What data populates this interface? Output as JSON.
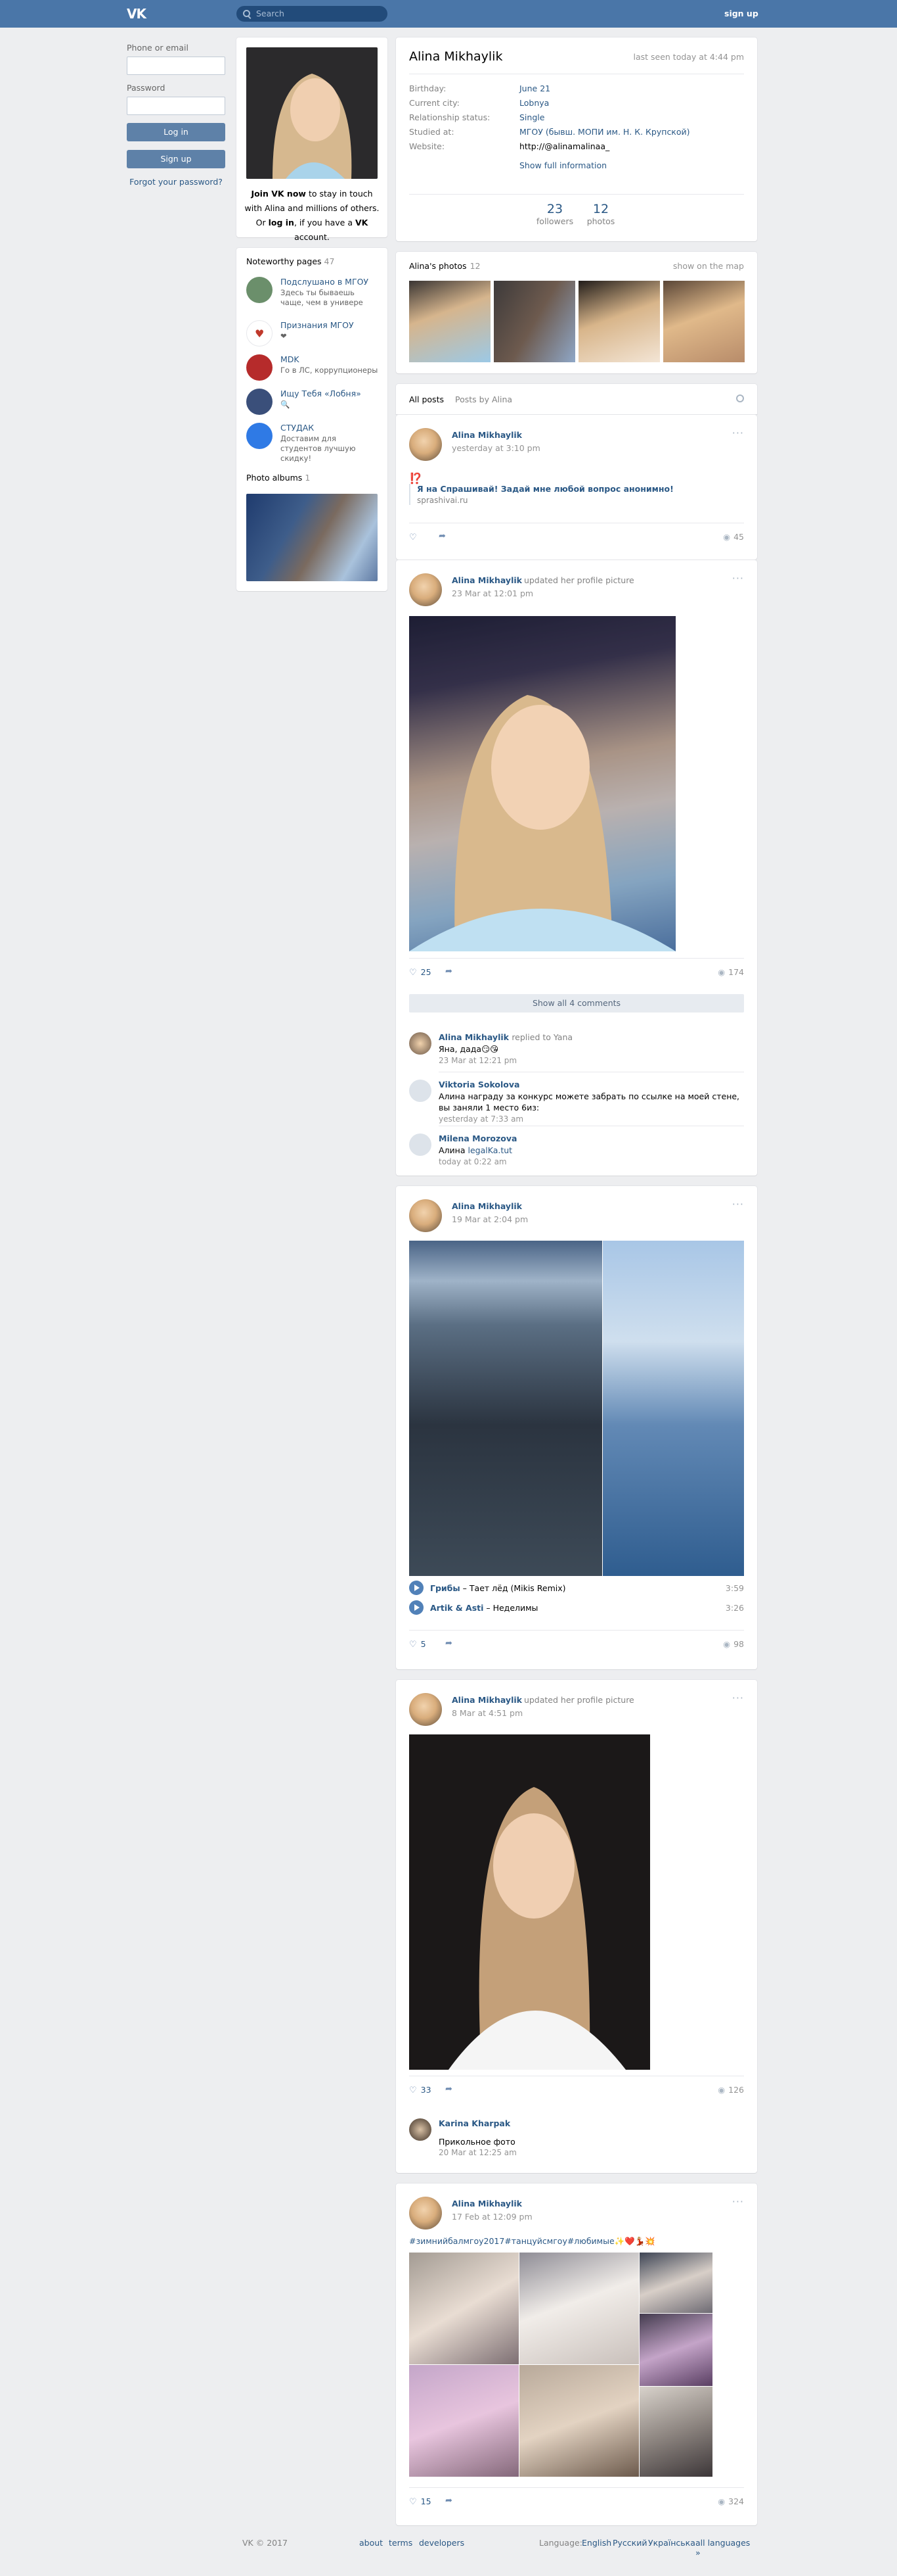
{
  "header": {
    "logo": "VK",
    "search_placeholder": "Search",
    "signup": "sign up"
  },
  "login": {
    "phone_label": "Phone or email",
    "password_label": "Password",
    "login_button": "Log in",
    "signup_button": "Sign up",
    "forgot": "Forgot your password?"
  },
  "sidebar": {
    "join_text_1": "Join VK now",
    "join_text_2": " to stay in touch with Alina and millions of others.",
    "join_text_3": "Or ",
    "join_text_4": "log in",
    "join_text_5": ", if you have a ",
    "join_text_6": "VK",
    "join_text_7": " account.",
    "noteworthy_title": "Noteworthy pages",
    "noteworthy_count": "47",
    "pages": [
      {
        "name": "Подслушано в МГОУ",
        "desc": "Здесь ты бываешь чаще, чем в универе",
        "color": "#6b8f6b"
      },
      {
        "name": "Признания МГОУ",
        "desc": "❤",
        "color": "#ffffff"
      },
      {
        "name": "MDK",
        "desc": "Го в ЛС, коррупционеры",
        "color": "#b62b2b"
      },
      {
        "name": "Ищу Тебя «Лобня»",
        "desc": "🔍",
        "color": "#3a4f7a"
      },
      {
        "name": "СТУДАК",
        "desc": "Доставим для студентов лучшую скидку!",
        "color": "#2f7ae5"
      }
    ],
    "albums_title": "Photo albums",
    "albums_count": "1"
  },
  "profile": {
    "name": "Alina Mikhaylik",
    "last_seen": "last seen today at 4:44 pm",
    "rows": [
      {
        "k": "Birthday:",
        "v": "June 21",
        "link": true
      },
      {
        "k": "Current city:",
        "v": "Lobnya",
        "link": true
      },
      {
        "k": "Relationship status:",
        "v": "Single",
        "link": true
      },
      {
        "k": "Studied at:",
        "v": "МГОУ (бывш. МОПИ им. Н. К. Крупской)",
        "link": true
      },
      {
        "k": "Website:",
        "v": "http://@alinamalinaa_",
        "link": false
      }
    ],
    "show_full": "Show full information",
    "followers_n": "23",
    "followers_t": "followers",
    "photos_n": "12",
    "photos_t": "photos"
  },
  "photos_block": {
    "title": "Alina's photos",
    "count": "12",
    "map": "show on the map"
  },
  "tabs": {
    "all": "All posts",
    "by": "Posts by Alina"
  },
  "posts": [
    {
      "author": "Alina Mikhaylik",
      "date": "yesterday at 3:10 pm",
      "mark": "⁉️",
      "link_title": "Я на Спрашивай! Задай мне любой вопрос анонимно!",
      "link_domain": "sprashivai.ru",
      "views": "45"
    },
    {
      "author": "Alina Mikhaylik",
      "action": "updated her profile picture",
      "date": "23 Mar at 12:01 pm",
      "likes": "25",
      "views": "174",
      "show_comments": "Show all 4 comments",
      "comments": [
        {
          "name": "Alina Mikhaylik",
          "reply": "replied to Yana",
          "text": "Яна, дада😏😘",
          "date": "23 Mar at 12:21 pm"
        },
        {
          "name": "Viktoria Sokolova",
          "text": "Алина награду за конкурс можете забрать по ссылке на моей стене, вы заняли 1 место 6из:",
          "date": "yesterday at 7:33 am"
        },
        {
          "name": "Milena Morozova",
          "text1": "Алина ",
          "text_link": "legalKa.tut",
          "date": "today at 0:22 am"
        }
      ]
    },
    {
      "author": "Alina Mikhaylik",
      "date": "19 Mar at 2:04 pm",
      "tracks": [
        {
          "artist": "Грибы",
          "title": "Тает лёд (Mikis Remix)",
          "dur": "3:59"
        },
        {
          "artist": "Artik & Asti",
          "title": "Неделимы",
          "dur": "3:26"
        }
      ],
      "likes": "5",
      "views": "98"
    },
    {
      "author": "Alina Mikhaylik",
      "action": "updated her profile picture",
      "date": "8 Mar at 4:51 pm",
      "likes": "33",
      "views": "126",
      "comments": [
        {
          "name": "Karina Kharpak",
          "text": "Прикольное фото",
          "date": "20 Mar at 12:25 am"
        }
      ]
    },
    {
      "author": "Alina Mikhaylik",
      "date": "17 Feb at 12:09 pm",
      "text": "#зимнийбалмгоу2017#танцуйсмгоу#любимые✨❤️💃🏼💥",
      "likes": "15",
      "views": "324"
    }
  ],
  "footer": {
    "copy": "VK © 2017",
    "about": "about",
    "terms": "terms",
    "developers": "developers",
    "language": "Language:",
    "lang1": "English",
    "lang2": "Русский",
    "lang3": "Українська",
    "all": "all languages »"
  },
  "colors": {
    "header": "#4a76a8",
    "accent": "#2a5885",
    "button": "#5e81a8",
    "background": "#edeef0"
  }
}
